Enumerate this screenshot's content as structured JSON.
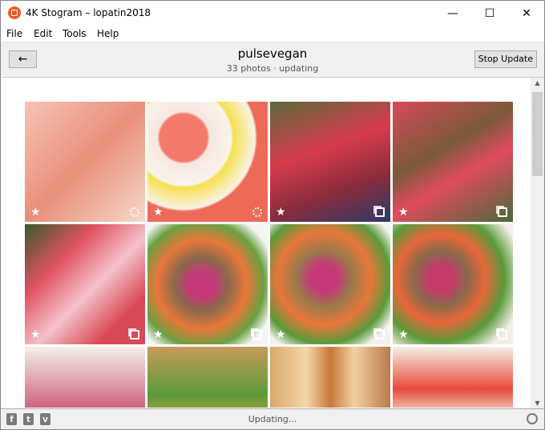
{
  "window": {
    "title": "4K Stogram – lopatin2018",
    "minimize": "—",
    "maximize": "☐",
    "close": "✕"
  },
  "menu": [
    "File",
    "Edit",
    "Tools",
    "Help"
  ],
  "header": {
    "back": "←",
    "account": "pulsevegan",
    "subtitle": "33 photos · updating",
    "stop_button": "Stop Update"
  },
  "photos": [
    {
      "type": "circle",
      "bg": "linear-gradient(135deg,#f7c3b5,#e88f7a 50%,#f4d9c8)"
    },
    {
      "type": "circle",
      "bg": "radial-gradient(circle at 30% 30%,#f47b6b 20%,#f7e7e0 22%,#f9f3e8 40%,#f6e04f 42%,#f8f2e6 60%,#ee6a58 62%)"
    },
    {
      "type": "carousel",
      "bg": "linear-gradient(160deg,#5a6a3a,#d83c4e 40%,#8a2c3c 70%,#2c3a6a)"
    },
    {
      "type": "carousel",
      "bg": "linear-gradient(150deg,#d84a5a,#7a5a3a 40%,#e04c5e 60%,#4a6a3a)"
    },
    {
      "type": "carousel",
      "bg": "linear-gradient(135deg,#3a5a2a,#e05262 30%,#f3c2c8 55%,#d84a56 80%)"
    },
    {
      "type": "carousel",
      "bg": "radial-gradient(circle at 45% 50%,#c63a7a 15%,#8a6a4a 30%,#e8763a 50%,#6aa040 70%,#f4f4f4 85%)"
    },
    {
      "type": "carousel",
      "bg": "radial-gradient(circle at 45% 45%,#c63a7a 15%,#9a7a4a 30%,#e8763a 50%,#5a9a3a 70%,#f4f2ee 85%)"
    },
    {
      "type": "carousel",
      "bg": "radial-gradient(circle at 40% 45%,#c63a6a 12%,#8a6a4a 28%,#e8663a 45%,#5a9a3a 65%,#f2eee8 85%)"
    },
    {
      "type": "none",
      "bg": "linear-gradient(180deg,#f4f0ea,#c64a6a 60%,#e8863a)"
    },
    {
      "type": "none",
      "bg": "linear-gradient(180deg,#c89a5a,#5a9a3a 40%,#e8a43a 70%,#8a6a4a)"
    },
    {
      "type": "none",
      "bg": "linear-gradient(90deg,#d8a86a,#f4d8a8 30%,#c8783a 50%,#f2d0a0 70%,#b87a4a)"
    },
    {
      "type": "none",
      "bg": "linear-gradient(180deg,#f4f0e8,#e84a3a 35%,#f0eadf 60%,#e89a4a)"
    }
  ],
  "status": {
    "text": "Updating...",
    "social": [
      "f",
      "t",
      "v"
    ]
  }
}
